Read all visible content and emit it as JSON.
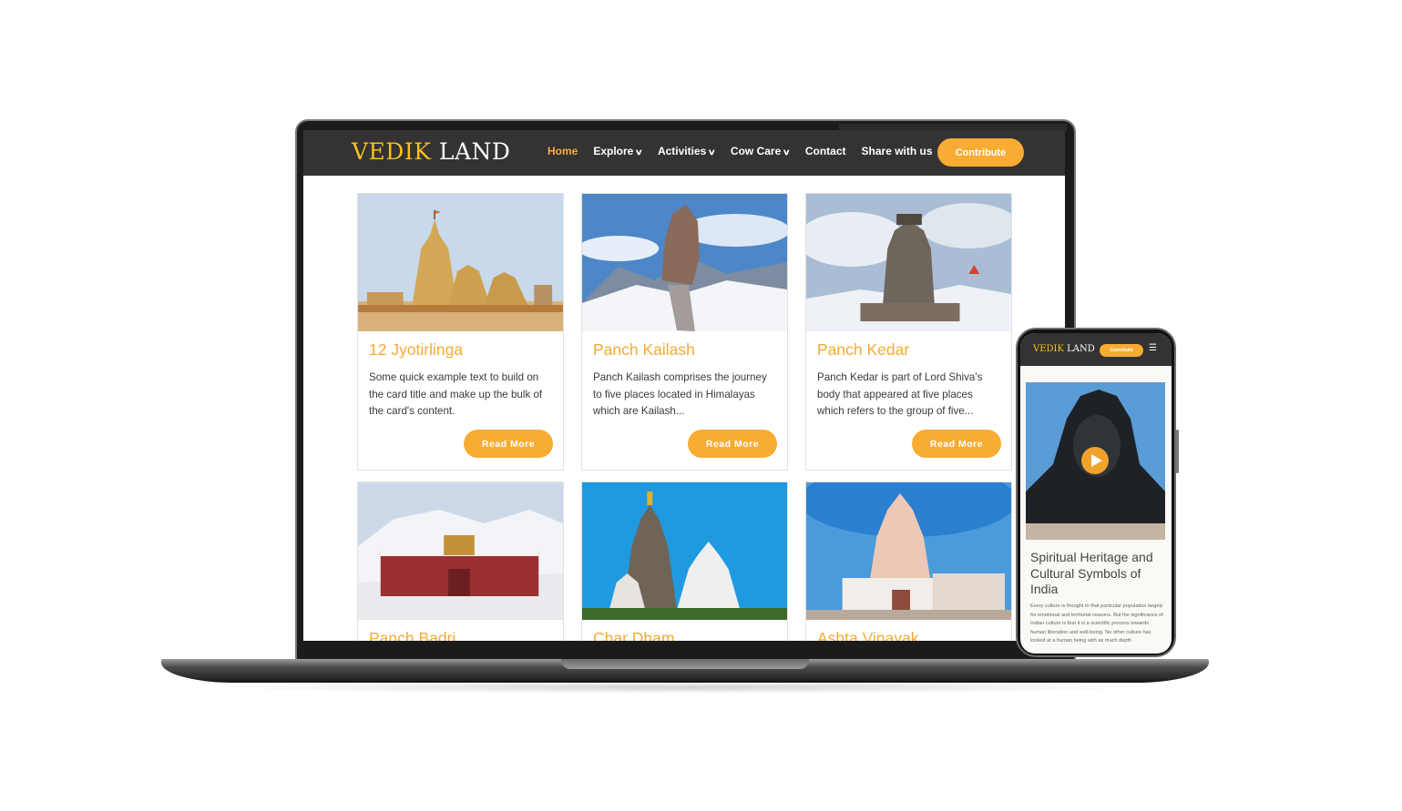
{
  "brand": {
    "part1": "VEDIK",
    "part2": "LAND"
  },
  "nav": {
    "items": [
      {
        "label": "Home",
        "active": true,
        "dropdown": false
      },
      {
        "label": "Explore",
        "active": false,
        "dropdown": true
      },
      {
        "label": "Activities",
        "active": false,
        "dropdown": true
      },
      {
        "label": "Cow Care",
        "active": false,
        "dropdown": true
      },
      {
        "label": "Contact",
        "active": false,
        "dropdown": false
      },
      {
        "label": "Share with us",
        "active": false,
        "dropdown": false
      }
    ],
    "contribute_label": "Contribute"
  },
  "cards": [
    {
      "title": "12 Jyotirlinga",
      "text": "Some quick example text to build on the card title and make up the bulk of the card's content.",
      "button": "Read More"
    },
    {
      "title": "Panch Kailash",
      "text": "Panch Kailash comprises the journey to five places located in Himalayas which are Kailash...",
      "button": "Read More"
    },
    {
      "title": "Panch Kedar",
      "text": "Panch Kedar is part of Lord Shiva's body that appeared at five places which refers to the group of five...",
      "button": "Read More"
    },
    {
      "title": "Panch Badri"
    },
    {
      "title": "Char Dham"
    },
    {
      "title": "Ashta Vinayak"
    }
  ],
  "mobile": {
    "contribute_label": "Contribute",
    "title": "Spiritual Heritage and Cultural Symbols of India",
    "text": "Every culture is thought to that particular population largely for emotional and territorial reasons. But the significance of Indian culture is that it is a scientific process towards human liberation and well-being. No other culture has looked at a human being with as much depth"
  },
  "colors": {
    "accent": "#f8ac33",
    "nav_bg": "#343232",
    "brand_gold": "#f5c11a"
  }
}
